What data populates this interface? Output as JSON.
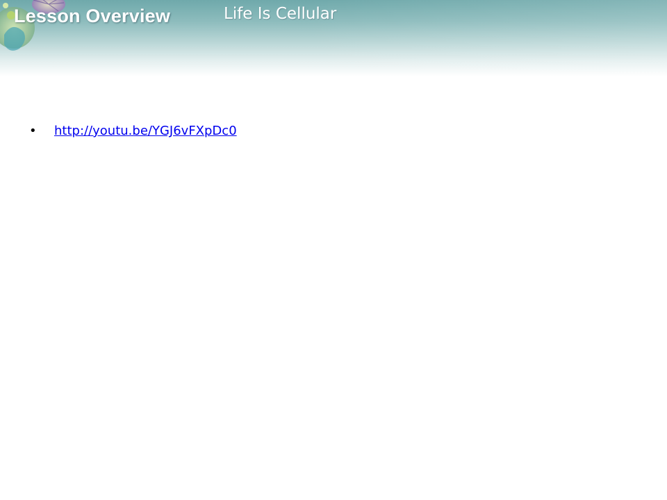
{
  "header": {
    "lesson_label": "Lesson Overview",
    "title": "Life Is Cellular",
    "logo_icon": "cell-collage-icon",
    "band_color": "#7fb3b5"
  },
  "content": {
    "bullets": [
      {
        "text": "http://youtu.be/YGJ6vFXpDc0",
        "is_link": true,
        "link_color": "#0000ee"
      }
    ]
  }
}
